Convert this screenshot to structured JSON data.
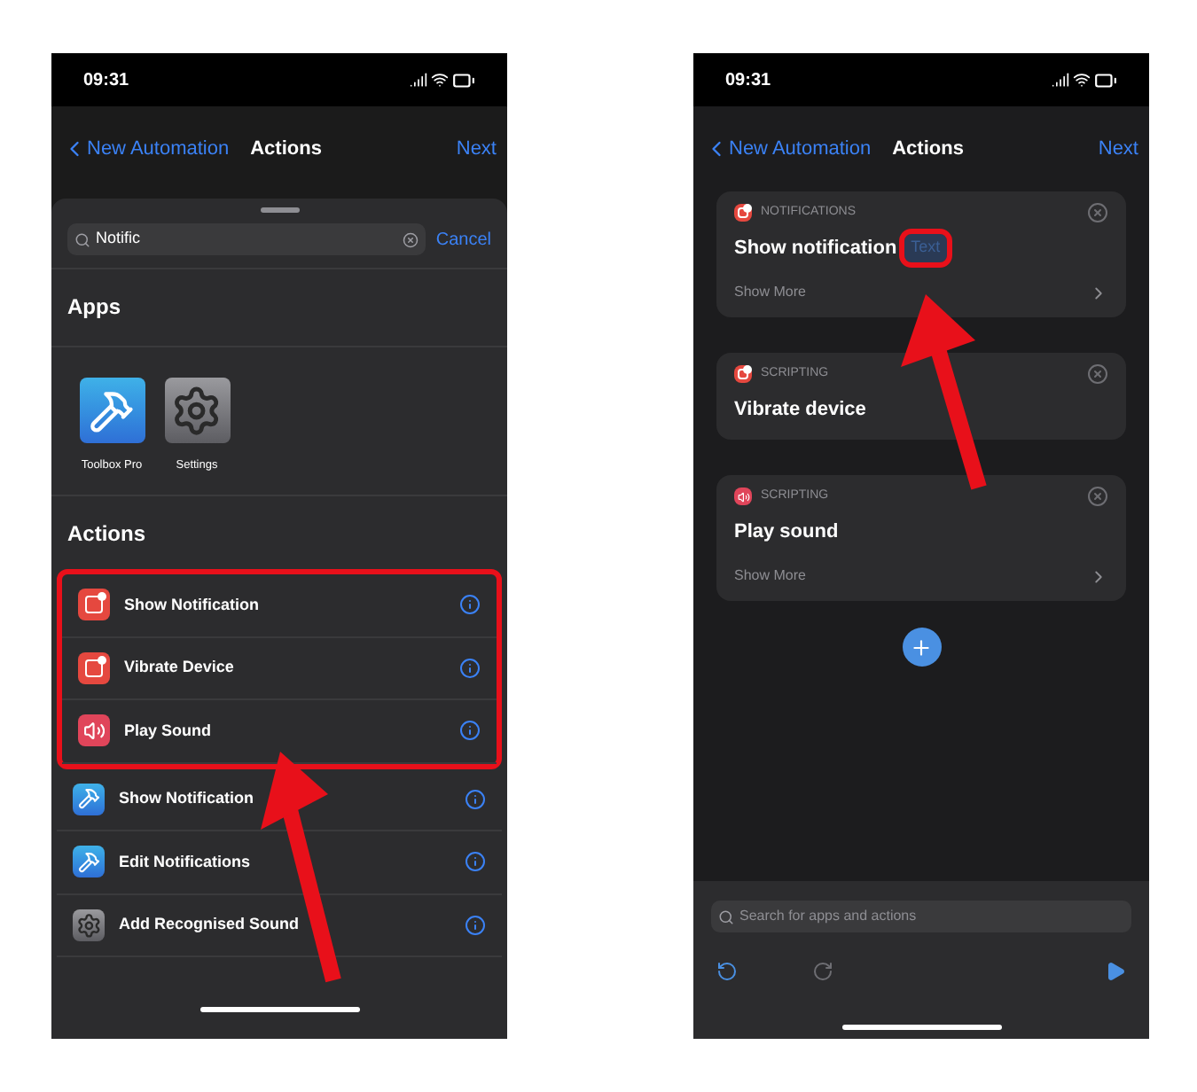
{
  "left_screen": {
    "status_time": "09:31",
    "nav": {
      "back": "New Automation",
      "title": "Actions",
      "next": "Next"
    },
    "search": {
      "value": "Notific",
      "cancel": "Cancel"
    },
    "apps_heading": "Apps",
    "apps": [
      {
        "label": "Toolbox Pro",
        "kind": "toolbox"
      },
      {
        "label": "Settings",
        "kind": "settings"
      }
    ],
    "actions_heading": "Actions",
    "actions": [
      {
        "label": "Show Notification",
        "kind": "notification",
        "highlighted": true
      },
      {
        "label": "Vibrate Device",
        "kind": "notification",
        "highlighted": true
      },
      {
        "label": "Play Sound",
        "kind": "sound",
        "highlighted": true
      },
      {
        "label": "Show Notification",
        "kind": "toolbox",
        "highlighted": false
      },
      {
        "label": "Edit Notifications",
        "kind": "toolbox",
        "highlighted": false
      },
      {
        "label": "Add Recognised Sound",
        "kind": "settings",
        "highlighted": false
      }
    ]
  },
  "right_screen": {
    "status_time": "09:31",
    "nav": {
      "back": "New Automation",
      "title": "Actions",
      "next": "Next"
    },
    "cards": [
      {
        "kind": "notification",
        "category": "NOTIFICATIONS",
        "title": "Show notification",
        "parameter": "Text",
        "parameter_highlighted": true,
        "show_more": "Show More"
      },
      {
        "kind": "notification",
        "category": "SCRIPTING",
        "title": "Vibrate device"
      },
      {
        "kind": "sound",
        "category": "SCRIPTING",
        "title": "Play sound",
        "show_more": "Show More"
      }
    ],
    "search": {
      "placeholder": "Search for apps and actions"
    }
  }
}
